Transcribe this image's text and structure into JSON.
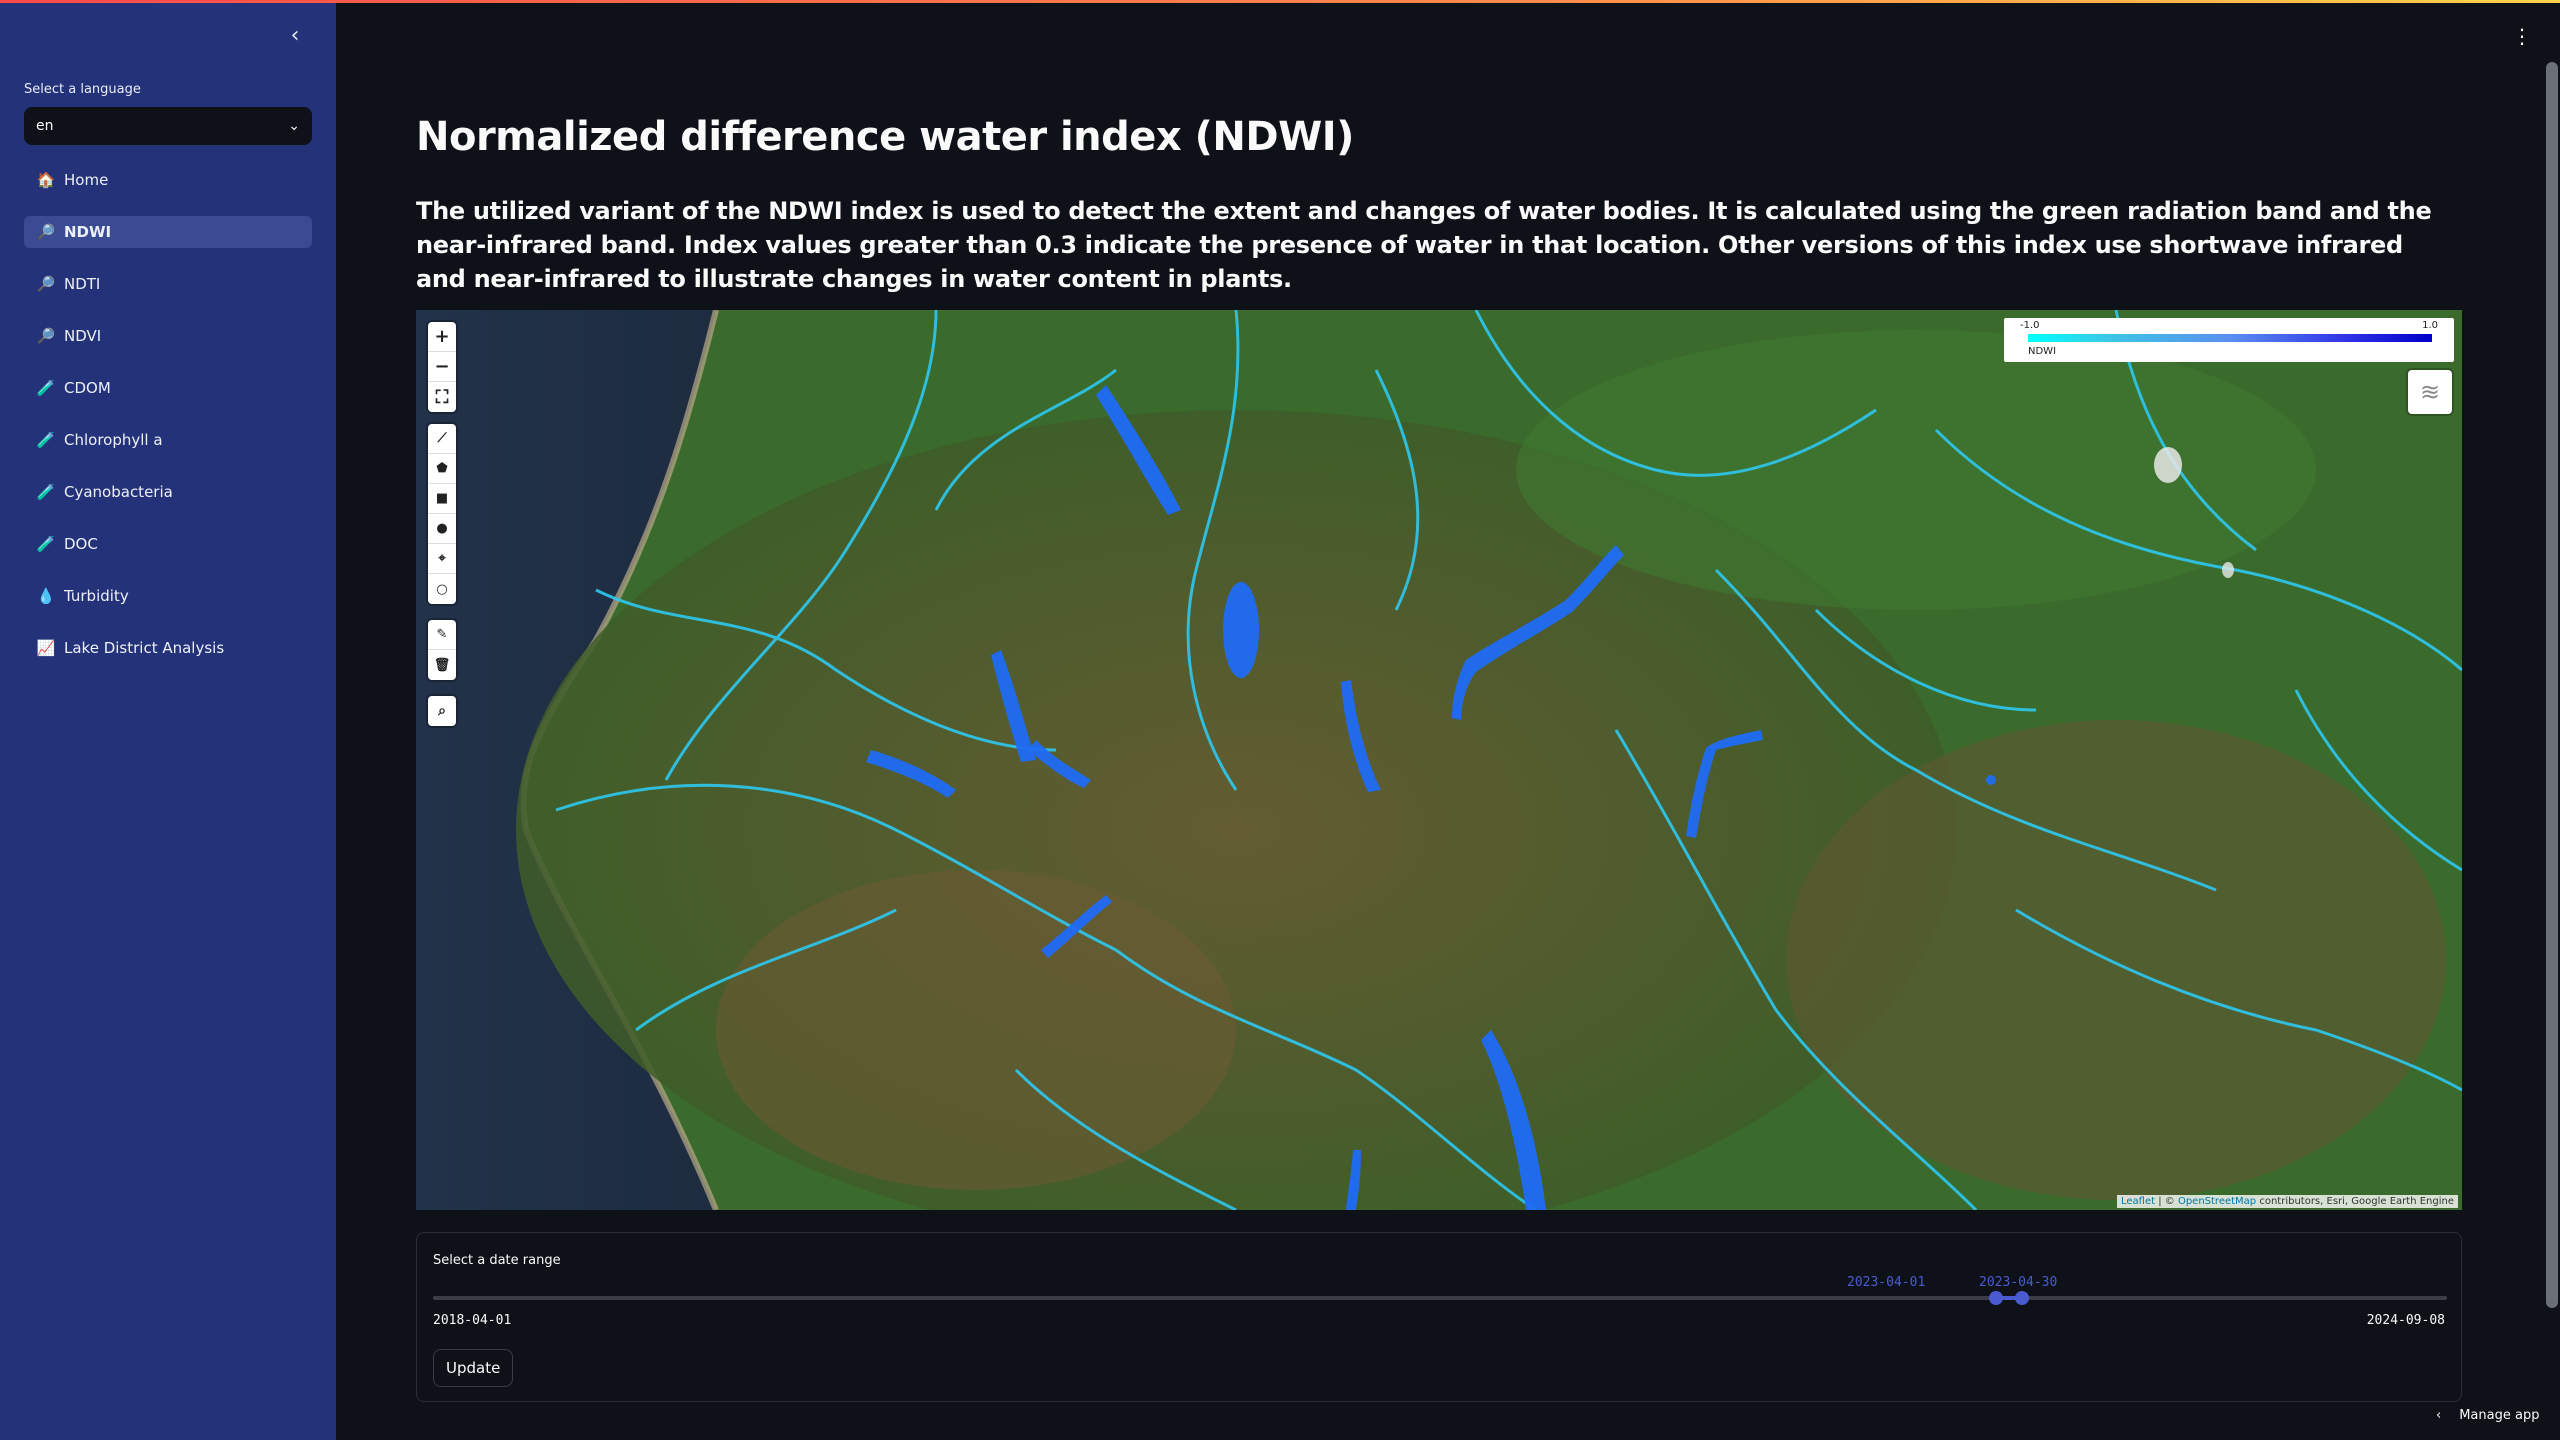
{
  "sidebar": {
    "language_label": "Select a language",
    "language_value": "en",
    "items": [
      {
        "label": "Home",
        "icon": "🏠"
      },
      {
        "label": "NDWI",
        "icon": "🔎"
      },
      {
        "label": "NDTI",
        "icon": "🔎"
      },
      {
        "label": "NDVI",
        "icon": "🔎"
      },
      {
        "label": "CDOM",
        "icon": "🧪"
      },
      {
        "label": "Chlorophyll a",
        "icon": "🧪"
      },
      {
        "label": "Cyanobacteria",
        "icon": "🧪"
      },
      {
        "label": "DOC",
        "icon": "🧪"
      },
      {
        "label": "Turbidity",
        "icon": "💧"
      },
      {
        "label": "Lake District Analysis",
        "icon": "📈"
      }
    ],
    "active_index": 1
  },
  "main": {
    "title": "Normalized difference water index (NDWI)",
    "description": "The utilized variant of the NDWI index is used to detect the extent and changes of water bodies. It is calculated using the green radiation band and the near-infrared band. Index values greater than 0.3 indicate the presence of water in that location. Other versions of this index use shortwave infrared and near-infrared to illustrate changes in water content in plants."
  },
  "map": {
    "legend_min": "-1.0",
    "legend_max": "1.0",
    "legend_name": "NDWI",
    "attribution_leaflet": "Leaflet",
    "attribution_sep": " | © ",
    "attribution_osm": "OpenStreetMap",
    "attribution_rest": " contributors, Esri, Google Earth Engine"
  },
  "date_range": {
    "label": "Select a date range",
    "min": "2018-04-01",
    "max": "2024-09-08",
    "start": "2023-04-01",
    "end": "2023-04-30",
    "update_label": "Update"
  },
  "footer": {
    "manage_app": "Manage app"
  }
}
